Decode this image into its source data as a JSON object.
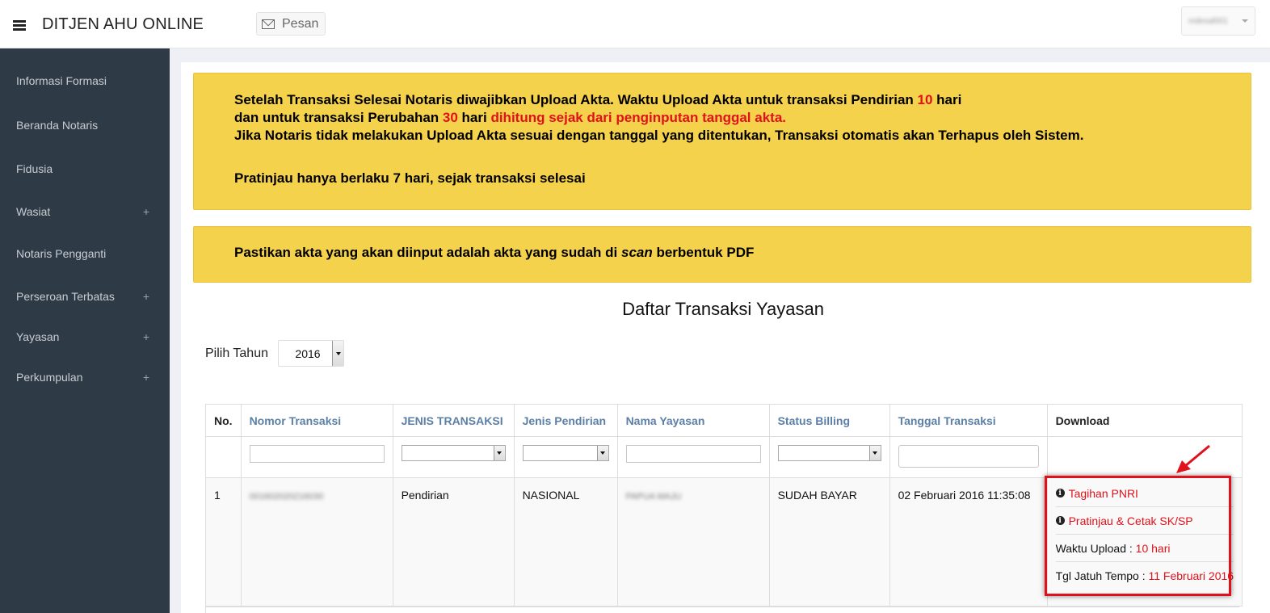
{
  "header": {
    "brand": "DITJEN AHU ONLINE",
    "message_button": "Pesan",
    "user_name": "mdesal001"
  },
  "sidebar": {
    "items": [
      {
        "label": "Informasi Formasi",
        "expandable": false
      },
      {
        "label": "Beranda Notaris",
        "expandable": false
      },
      {
        "label": "Fidusia",
        "expandable": false
      },
      {
        "label": "Wasiat",
        "expandable": true
      },
      {
        "label": "Notaris Pengganti",
        "expandable": false
      },
      {
        "label": "Perseroan Terbatas",
        "expandable": true
      },
      {
        "label": "Yayasan",
        "expandable": true
      },
      {
        "label": "Perkumpulan",
        "expandable": true
      }
    ],
    "plus": "+"
  },
  "alerts": {
    "a1_l1_p1": "Setelah Transaksi Selesai Notaris diwajibkan Upload Akta. Waktu Upload Akta untuk transaksi Pendirian ",
    "a1_l1_red": "10",
    "a1_l1_p2": " hari",
    "a1_l2_p1": "dan untuk transaksi Perubahan ",
    "a1_l2_red1": "30",
    "a1_l2_p2": " hari ",
    "a1_l2_red2": "dihitung sejak dari penginputan tanggal akta.",
    "a1_l3": "Jika Notaris tidak melakukan Upload Akta sesuai dengan tanggal yang ditentukan, Transaksi otomatis akan Terhapus oleh Sistem.",
    "a1_l4": "Pratinjau hanya berlaku 7 hari, sejak transaksi selesai",
    "a2_p1": "Pastikan akta yang akan diinput adalah akta yang sudah di ",
    "a2_em": "scan",
    "a2_p2": " berbentuk PDF"
  },
  "page": {
    "title": "Daftar Transaksi Yayasan",
    "year_label": "Pilih Tahun",
    "year_value": "2016"
  },
  "table": {
    "headers": [
      "No.",
      "Nomor Transaksi",
      "JENIS TRANSAKSI",
      "Jenis Pendirian",
      "Nama Yayasan",
      "Status Billing",
      "Tanggal Transaksi",
      "Download"
    ],
    "rows": [
      {
        "no": "1",
        "nomor": "001602020216030",
        "jenis_transaksi": "Pendirian",
        "jenis_pendirian": "NASIONAL",
        "nama": "PAPUA MAJU",
        "status": "SUDAH BAYAR",
        "tanggal": "02 Februari 2016 11:35:08",
        "download": {
          "tagihan": "Tagihan PNRI",
          "pratinjau": "Pratinjau & Cetak SK/SP",
          "waktu_label": "Waktu Upload : ",
          "waktu_value": "10 hari",
          "jatuh_label": "Tgl Jatuh Tempo : ",
          "jatuh_value": "11 Februari 2016"
        }
      }
    ]
  },
  "colors": {
    "alert_bg": "#f5d24b",
    "sidebar_bg": "#2e3a46",
    "header_link": "#5b7fa6",
    "danger": "#e0111a",
    "success": "#1a9a1a"
  },
  "icons": [
    "hamburger-icon",
    "envelope-icon",
    "caret-down-icon",
    "info-circle-icon",
    "annotation-arrow-icon"
  ]
}
